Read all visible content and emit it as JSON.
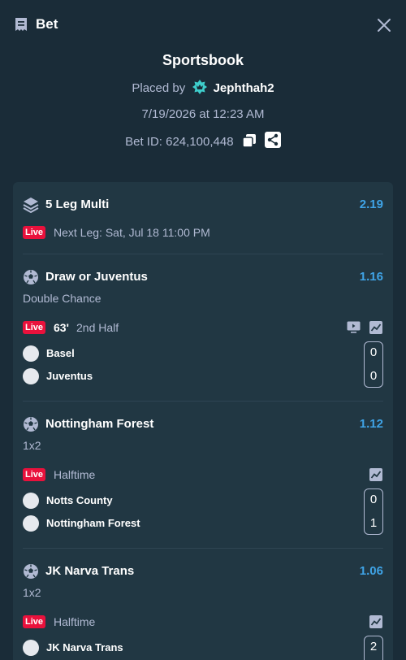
{
  "header": {
    "title": "Bet"
  },
  "summary": {
    "source": "Sportsbook",
    "placed_by_prefix": "Placed by",
    "username": "Jephthah2",
    "datetime": "7/19/2026 at 12:23 AM",
    "bet_id": "Bet ID: 624,100,448"
  },
  "multi": {
    "title": "5 Leg Multi",
    "odds": "2.19",
    "live_badge": "Live",
    "next_leg": "Next Leg: Sat, Jul 18 11:00 PM"
  },
  "legs": [
    {
      "selection": "Draw or Juventus",
      "odds": "1.16",
      "market": "Double Chance",
      "live_badge": "Live",
      "minute": "63'",
      "period": "2nd Half",
      "teams": [
        {
          "name": "Basel",
          "score": "0"
        },
        {
          "name": "Juventus",
          "score": "0"
        }
      ]
    },
    {
      "selection": "Nottingham Forest",
      "odds": "1.12",
      "market": "1x2",
      "live_badge": "Live",
      "period": "Halftime",
      "teams": [
        {
          "name": "Notts County",
          "score": "0"
        },
        {
          "name": "Nottingham Forest",
          "score": "1"
        }
      ]
    },
    {
      "selection": "JK Narva Trans",
      "odds": "1.06",
      "market": "1x2",
      "live_badge": "Live",
      "period": "Halftime",
      "teams": [
        {
          "name": "JK Narva Trans",
          "score": "2"
        }
      ]
    }
  ],
  "icons": {
    "header": "bet-slip-icon",
    "close": "close-icon",
    "user": "crown-icon",
    "copy": "copy-icon",
    "share": "share-icon",
    "multi": "layers-icon",
    "sport": "soccer-ball-icon",
    "stream": "tv-icon",
    "stats": "chart-icon"
  },
  "colors": {
    "background": "#1a2c38",
    "card": "#213743",
    "odds": "#3fa3e6",
    "live": "#e9113c",
    "muted": "#b1bad3",
    "vip": "#3ecdcb"
  }
}
